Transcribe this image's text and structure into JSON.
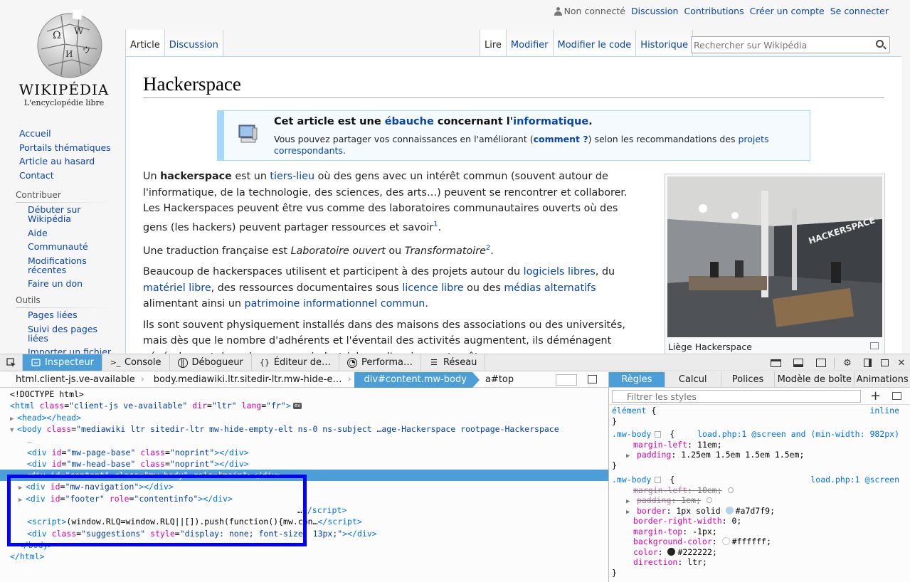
{
  "wiki": {
    "logo": {
      "wordmark": "Wikipédia",
      "tagline": "L'encyclopédie libre"
    },
    "personal": {
      "not_logged": "Non connecté",
      "links": [
        "Discussion",
        "Contributions",
        "Créer un compte",
        "Se connecter"
      ]
    },
    "tabs_left": [
      {
        "label": "Article",
        "selected": true
      },
      {
        "label": "Discussion",
        "selected": false
      }
    ],
    "tabs_right": [
      {
        "label": "Lire",
        "selected": true
      },
      {
        "label": "Modifier",
        "selected": false
      },
      {
        "label": "Modifier le code",
        "selected": false
      },
      {
        "label": "Historique",
        "selected": false
      }
    ],
    "search_placeholder": "Rechercher sur Wikipédia",
    "nav_main": [
      "Accueil",
      "Portails thématiques",
      "Article au hasard",
      "Contact"
    ],
    "nav_contribuer": {
      "heading": "Contribuer",
      "items": [
        "Débuter sur Wikipédia",
        "Aide",
        "Communauté",
        "Modifications récentes",
        "Faire un don"
      ]
    },
    "nav_outils": {
      "heading": "Outils",
      "items": [
        "Pages liées",
        "Suivi des pages liées",
        "Importer un fichier"
      ]
    },
    "title": "Hackerspace",
    "stub": {
      "title_pre": "Cet article est une ",
      "title_link1": "ébauche",
      "title_mid": " concernant l'",
      "title_link2": "informatique",
      "title_post": ".",
      "text_pre": "Vous pouvez partager vos connaissances en l'améliorant (",
      "text_link": "comment ?",
      "text_mid": ") selon les recommandations des ",
      "text_link2": "projets correspondants",
      "text_post": "."
    },
    "paragraphs": {
      "p1_a": "Un ",
      "p1_b": "hackerspace",
      "p1_c": " est un ",
      "p1_link": "tiers-lieu",
      "p1_d": " où des gens avec un intérêt commun (souvent autour de l'informatique, de la technologie, des sciences, des arts…) peuvent se rencontrer et collaborer. Les Hackerspaces peuvent être vus comme des laboratoires communautaires ouverts où des gens (les hackers) peuvent partager ressources et savoir",
      "p1_sup": "1",
      "p2_a": "Une traduction française est ",
      "p2_b": "Laboratoire ouvert",
      "p2_c": " ou ",
      "p2_d": "Transformatoire",
      "p2_sup": "2",
      "p3_a": "Beaucoup de hackerspaces utilisent et participent à des projets autour du ",
      "p3_l1": "logiciels libres",
      "p3_b": ", du ",
      "p3_l2": "matériel libre",
      "p3_c": ", des ressources documentaires sous ",
      "p3_l3": "licence libre",
      "p3_d": " ou des ",
      "p3_l4": "médias alternatifs",
      "p3_e": " alimentant ainsi un ",
      "p3_l5": "patrimoine informationnel commun",
      "p3_f": ".",
      "p4": "Ils sont souvent physiquement installés dans des maisons des associations ou des universités, mais dès que le nombre d'adhérents et l'éventail des activités augmentent, ils déménagent généralement dans des espaces industriels ou d'anciens entrepôts."
    },
    "thumb_caption": "Liège Hackerspace",
    "thumb_sign": "HACKERSPACE"
  },
  "devtools": {
    "tabs": [
      {
        "label": "Inspecteur",
        "icon": "inspector-icon",
        "selected": true
      },
      {
        "label": "Console",
        "icon": "console-icon",
        "selected": false
      },
      {
        "label": "Débogueur",
        "icon": "debugger-icon",
        "selected": false
      },
      {
        "label": "Éditeur de…",
        "icon": "style-editor-icon",
        "selected": false
      },
      {
        "label": "Performa…",
        "icon": "performance-icon",
        "selected": false
      },
      {
        "label": "Réseau",
        "icon": "network-icon",
        "selected": false
      }
    ],
    "breadcrumbs": [
      {
        "label": "html.client-js.ve-available",
        "selected": false
      },
      {
        "label": "body.mediawiki.ltr.sitedir-ltr.mw-hide-e…",
        "selected": false
      },
      {
        "label": "div#content.mw-body",
        "selected": true
      },
      {
        "label": "a#top",
        "selected": false
      }
    ],
    "markup": {
      "l0": "<!DOCTYPE html>",
      "l1_attr1_val": "\"client-js ve-available\"",
      "l1_attr2_val": "\"ltr\"",
      "l1_attr3_val": "\"fr\"",
      "l1_badge": "ev",
      "l3_val": "\"mediawiki ltr sitedir-ltr mw-hide-empty-elt ns-0 ns-subject …age-Hackerspace rootpage-Hackerspace",
      "l5_id": "\"mw-page-base\"",
      "l6_id": "\"mw-head-base\"",
      "l7_id": "\"content\"",
      "l7_class": "\"mw-body\"",
      "l7_role": "\"main\"",
      "l8_id": "\"mw-navigation\"",
      "l9_id": "\"footer\"",
      "l9_role": "\"contentinfo\"",
      "noprint": "\"noprint\"",
      "l10_text": "…",
      "l11_text": "(window.RLQ=window.RLQ||[]).push(function(){mw.con…",
      "l12_class": "\"suggestions\"",
      "l12_style": "\"display: none; font-size: 13px;\""
    },
    "rules_tabs": [
      "Règles",
      "Calcul",
      "Polices",
      "Modèle de boîte",
      "Animations"
    ],
    "filter_placeholder": "Filtrer les styles",
    "rules": {
      "element_sel": "élément",
      "element_src": "inline",
      "r1_sel": ".mw-body",
      "r1_src": "load.php:1 @screen and (min-width: 982px)",
      "r1_p1": "margin-left",
      "r1_v1": "11em",
      "r1_p2": "padding",
      "r1_v2": "1.25em 1.5em 1.5em 1.5em",
      "r2_sel": ".mw-body",
      "r2_src": "load.php:1 @screen",
      "r2_p1": "margin-left",
      "r2_v1": "10em",
      "r2_p2": "padding",
      "r2_v2": "1em",
      "r2_p3": "border",
      "r2_v3": "1px solid",
      "r2_c3": "#a7d7f9",
      "r2_p4": "border-right-width",
      "r2_v4": "0",
      "r2_p5": "margin-top",
      "r2_v5": "-1px",
      "r2_p6": "background-color",
      "r2_c6": "#ffffff",
      "r2_p7": "color",
      "r2_c7": "#222222",
      "r2_p8": "direction",
      "r2_v8": "ltr"
    }
  },
  "colors": {
    "link": "#0645ad",
    "devtools_selected": "#4c9ed9",
    "annotation_box": "#0000ff"
  }
}
